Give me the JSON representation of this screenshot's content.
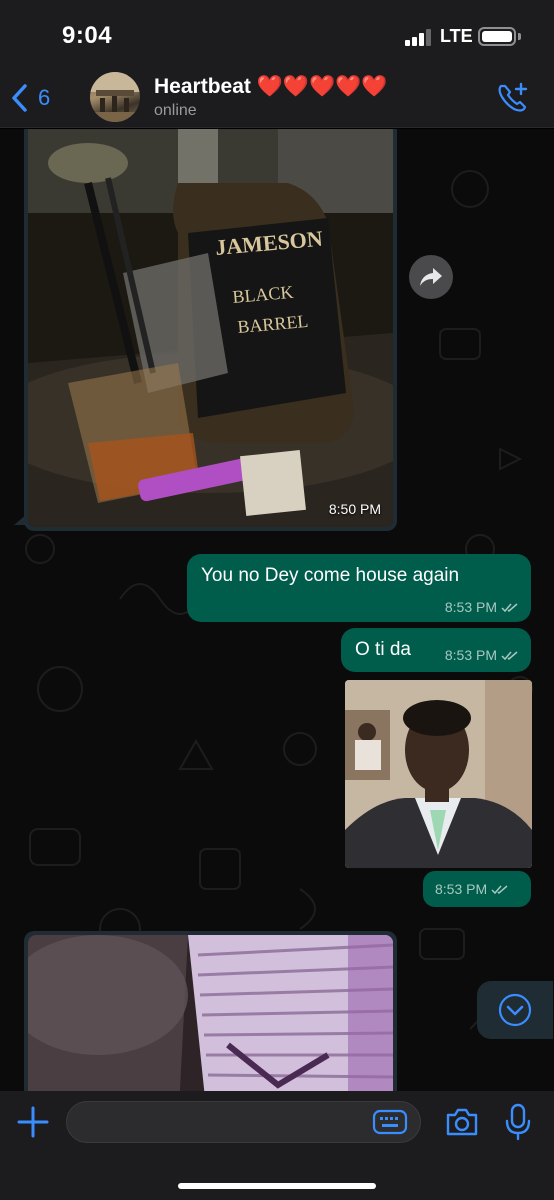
{
  "status_bar": {
    "time": "9:04",
    "network": "LTE"
  },
  "header": {
    "back_count": "6",
    "contact_name": "Heartbeat ❤️❤️❤️❤️❤️",
    "contact_status": "online",
    "icons": {
      "back": "chevron-left-icon",
      "call": "add-call-icon"
    }
  },
  "messages": [
    {
      "type": "photo",
      "direction": "incoming",
      "description_text": "JAMESON BLACK BARREL",
      "time": "8:50 PM"
    },
    {
      "type": "text",
      "direction": "outgoing",
      "text": "You no Dey come house again",
      "time": "8:53 PM",
      "read": true
    },
    {
      "type": "text",
      "direction": "outgoing",
      "text": "O ti da",
      "time": "8:53 PM",
      "read": true
    },
    {
      "type": "photo",
      "direction": "outgoing",
      "time": "8:53 PM",
      "read": true
    },
    {
      "type": "photo",
      "direction": "incoming"
    }
  ],
  "bottle_label": {
    "line1": "JAMESON",
    "line2": "BLACK",
    "line3": "BARREL"
  },
  "input": {
    "placeholder": ""
  },
  "colors": {
    "background": "#0b0b0b",
    "bar": "#1c1c1e",
    "outgoing_bubble": "#005c4b",
    "incoming_bubble": "#1f2c34",
    "accent": "#3a8dfd"
  }
}
